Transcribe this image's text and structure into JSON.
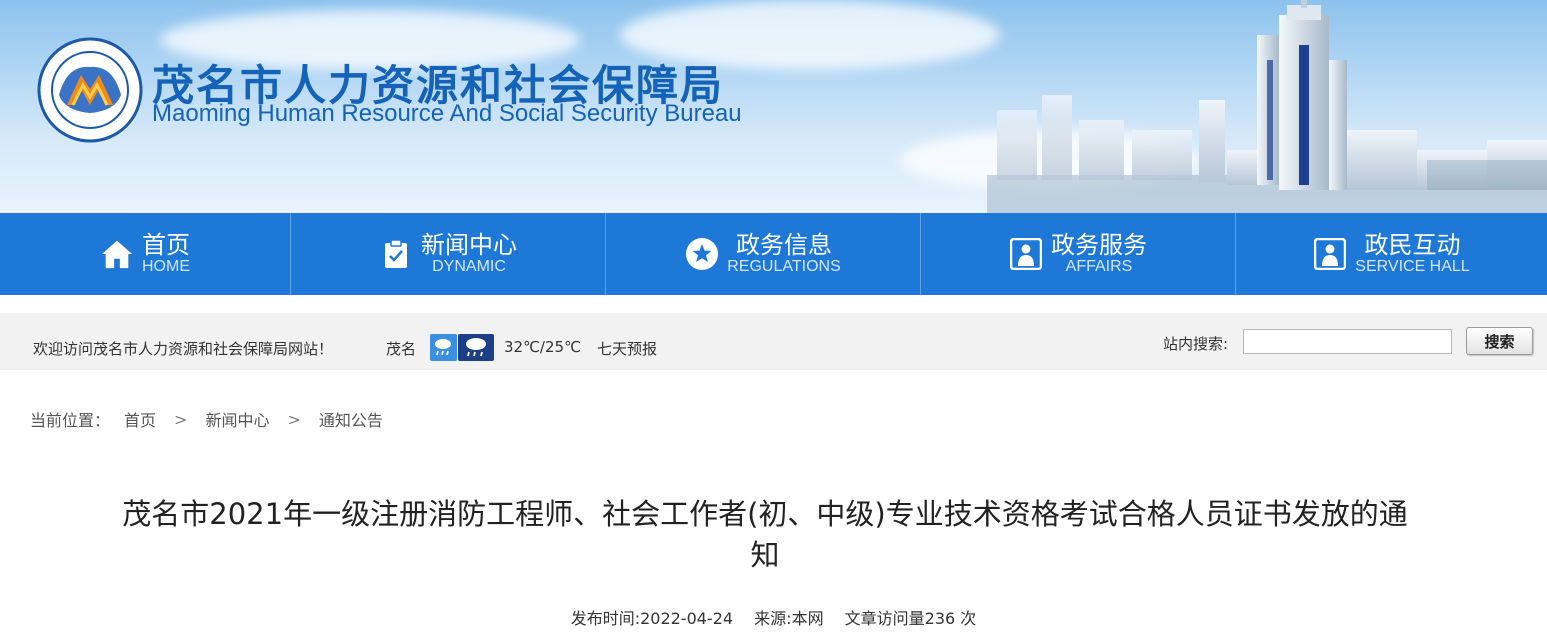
{
  "header": {
    "title_cn": "茂名市人力资源和社会保障局",
    "title_en": "Maoming Human Resource And Social Security Bureau",
    "logo_icon": "bureau-emblem-icon"
  },
  "nav": {
    "items": [
      {
        "label": "首页",
        "sub": "HOME",
        "icon": "home-icon"
      },
      {
        "label": "新闻中心",
        "sub": "DYNAMIC",
        "icon": "clipboard-check-icon"
      },
      {
        "label": "政务信息",
        "sub": "REGULATIONS",
        "icon": "star-circle-icon"
      },
      {
        "label": "政务服务",
        "sub": "AFFAIRS",
        "icon": "service-person-icon"
      },
      {
        "label": "政民互动",
        "sub": "SERVICE HALL",
        "icon": "service-person-icon"
      }
    ]
  },
  "infobar": {
    "welcome": "欢迎访问茂名市人力资源和社会保障局网站！",
    "city": "茂名",
    "weather_icons": [
      "rain-icon",
      "thunderstorm-icon"
    ],
    "temperature": "32℃/25℃",
    "forecast": "七天预报",
    "search_label": "站内搜索:",
    "search_value": "",
    "search_button": "搜索"
  },
  "breadcrumb": {
    "prefix": "当前位置：",
    "items": [
      "首页",
      "新闻中心",
      "通知公告"
    ],
    "separator": ">"
  },
  "article": {
    "title": "茂名市2021年一级注册消防工程师、社会工作者(初、中级)专业技术资格考试合格人员证书发放的通知",
    "publish_time": "发布时间:2022-04-24",
    "source": "来源:本网",
    "views": "文章访问量236 次"
  },
  "colors": {
    "nav_bg": "#1e78d8",
    "title_blue": "#1463b8",
    "infobar_bg": "#f2f2f2"
  }
}
